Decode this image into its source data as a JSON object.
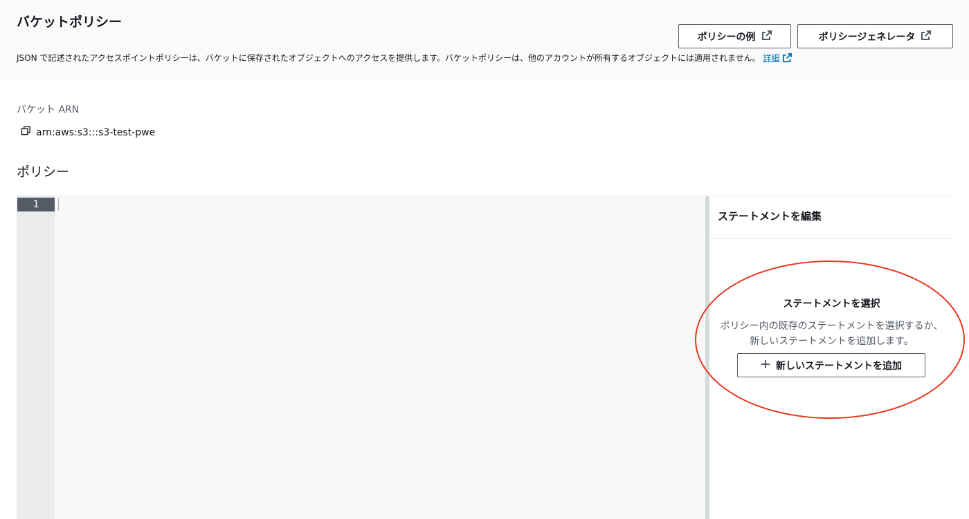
{
  "header": {
    "title": "バケットポリシー",
    "description": "JSON で記述されたアクセスポイントポリシーは、バケットに保存されたオブジェクトへのアクセスを提供します。バケットポリシーは、他のアカウントが所有するオブジェクトには適用されません。",
    "learn_more": "詳細",
    "buttons": {
      "policy_examples": "ポリシーの例",
      "policy_generator": "ポリシージェネレータ"
    }
  },
  "bucket": {
    "arn_label": "バケット ARN",
    "arn_value": "arn:aws:s3:::s3-test-pwe"
  },
  "policy": {
    "title": "ポリシー",
    "line_numbers": [
      "1"
    ]
  },
  "statement_panel": {
    "title": "ステートメントを編集",
    "empty_title": "ステートメントを選択",
    "empty_description": "ポリシー内の既存のステートメントを選択するか、新しいステートメントを追加します。",
    "add_button": "新しいステートメントを追加"
  },
  "icons": {
    "external_link": "external-link-icon",
    "copy": "copy-icon",
    "plus": "plus-icon"
  },
  "colors": {
    "link": "#0073bb",
    "highlight": "#e8361d",
    "line_number_bg": "#545b64"
  }
}
